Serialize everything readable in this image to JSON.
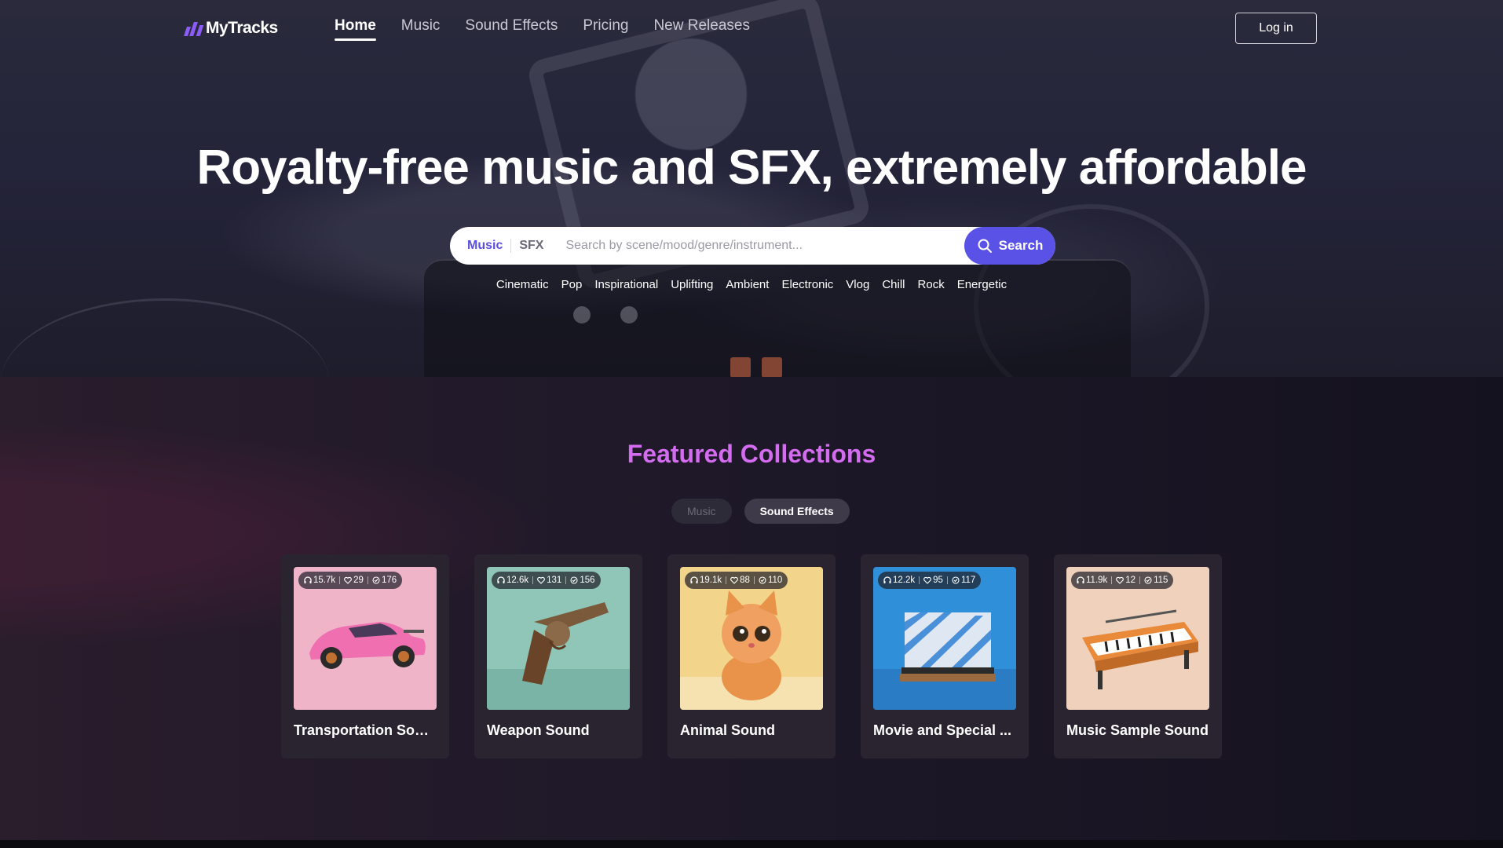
{
  "brand": {
    "name": "MyTracks",
    "accent": "#8b5cf6"
  },
  "nav": {
    "items": [
      {
        "label": "Home",
        "active": true
      },
      {
        "label": "Music",
        "active": false
      },
      {
        "label": "Sound Effects",
        "active": false
      },
      {
        "label": "Pricing",
        "active": false
      },
      {
        "label": "New Releases",
        "active": false
      }
    ],
    "login_label": "Log in"
  },
  "hero": {
    "title": "Royalty-free music and SFX, extremely affordable",
    "search": {
      "type_music": "Music",
      "type_sfx": "SFX",
      "placeholder": "Search by scene/mood/genre/instrument...",
      "button_label": "Search",
      "button_color": "#5a52e6"
    },
    "tags": [
      "Cinematic",
      "Pop",
      "Inspirational",
      "Uplifting",
      "Ambient",
      "Electronic",
      "Vlog",
      "Chill",
      "Rock",
      "Energetic"
    ]
  },
  "featured": {
    "title": "Featured Collections",
    "title_color": "#d46cf0",
    "toggles": [
      {
        "label": "Music",
        "active": false
      },
      {
        "label": "Sound Effects",
        "active": true
      }
    ],
    "cards": [
      {
        "title": "Transportation Sound",
        "plays": "15.7k",
        "likes": "29",
        "count": "176",
        "bg": "#f0b4c8",
        "icon": "pink-car-image"
      },
      {
        "title": "Weapon Sound",
        "plays": "12.6k",
        "likes": "131",
        "count": "156",
        "bg": "#8fc6b8",
        "icon": "revolver-image"
      },
      {
        "title": "Animal Sound",
        "plays": "19.1k",
        "likes": "88",
        "count": "110",
        "bg": "#f2d48a",
        "icon": "kitten-image"
      },
      {
        "title": "Movie and Special ...",
        "plays": "12.2k",
        "likes": "95",
        "count": "117",
        "bg": "#2f8fd8",
        "icon": "clapperboard-image"
      },
      {
        "title": "Music Sample Sound",
        "plays": "11.9k",
        "likes": "12",
        "count": "115",
        "bg": "#f0d2bc",
        "icon": "synthesizer-image"
      }
    ]
  }
}
